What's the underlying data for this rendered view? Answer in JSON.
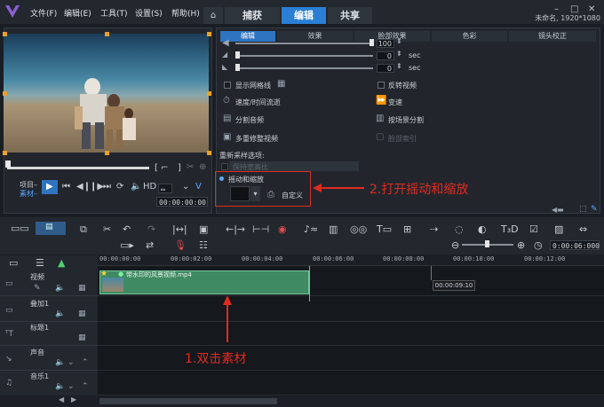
{
  "menu": {
    "file": "文件(F)",
    "edit": "编辑(E)",
    "tools": "工具(T)",
    "settings": "设置(S)",
    "help": "帮助(H)"
  },
  "window_controls": {
    "minimize": "–",
    "maximize": "□",
    "close": "✕"
  },
  "tabs": {
    "capture": "捕获",
    "edit": "编辑",
    "share": "共享"
  },
  "project_info": "未命名, 1920*1080",
  "preview": {
    "project_label": "项目–",
    "clip_label": "素材–",
    "timecode": "00:00:00:00"
  },
  "options_tabs": [
    "编辑",
    "效果",
    "脸部效果",
    "色彩",
    "镜头校正"
  ],
  "options": {
    "value_100": "100",
    "value_0a": "0",
    "value_0b": "0",
    "unit_sec": "sec",
    "show_grid": "显示网格线",
    "reverse_video": "反转视频",
    "speed_time": "速度/时间流逝",
    "speed_change": "变速",
    "split_audio": "分割音频",
    "split_by_scene": "按场景分割",
    "multi_trim": "多重修整视频",
    "face_index": "脸部索引",
    "resample_label": "重新采样选项:",
    "keep_ratio": "保持宽高比",
    "pan_zoom": "摇动和缩放",
    "customize": "自定义"
  },
  "annotations": {
    "step1": "1.双击素材",
    "step2": "2.打开摇动和缩放"
  },
  "timeline": {
    "ruler": [
      "00:00:00:00",
      "00:00:02:00",
      "00:00:04:00",
      "00:00:06:00",
      "00:00:08:00",
      "00:00:10:00",
      "00:00:12:00"
    ],
    "duration": "0:00:06:000",
    "hover_time": "00:00:09:10",
    "tracks": [
      "视频",
      "叠加1",
      "标题1",
      "声音",
      "音乐1"
    ],
    "clip_name": "带水印的风景视频.mp4"
  },
  "colors": {
    "accent": "#2a7fd4",
    "clip": "#3f8a62",
    "annotation": "#e02a20"
  }
}
